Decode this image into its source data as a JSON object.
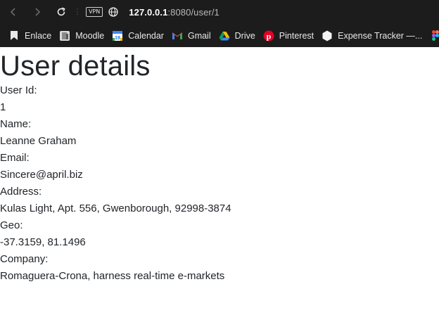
{
  "browser": {
    "vpn_label": "VPN",
    "url_host": "127.0.0.1",
    "url_path": ":8080/user/1"
  },
  "bookmarks": [
    {
      "label": "Enlace",
      "icon": "bookmark-folder-icon"
    },
    {
      "label": "Moodle",
      "icon": "moodle-icon"
    },
    {
      "label": "Calendar",
      "icon": "calendar-icon"
    },
    {
      "label": "Gmail",
      "icon": "gmail-icon"
    },
    {
      "label": "Drive",
      "icon": "drive-icon"
    },
    {
      "label": "Pinterest",
      "icon": "pinterest-icon"
    },
    {
      "label": "Expense Tracker —...",
      "icon": "hexagon-icon"
    }
  ],
  "page": {
    "title": "User details",
    "fields": [
      {
        "label": "User Id:",
        "value": "1"
      },
      {
        "label": "Name:",
        "value": "Leanne Graham"
      },
      {
        "label": "Email:",
        "value": "Sincere@april.biz"
      },
      {
        "label": "Address:",
        "value": "Kulas Light, Apt. 556, Gwenborough, 92998-3874"
      },
      {
        "label": "Geo:",
        "value": "-37.3159, 81.1496"
      },
      {
        "label": "Company:",
        "value": "Romaguera-Crona, harness real-time e-markets"
      }
    ]
  },
  "colors": {
    "chrome_bg": "#1c1c1c",
    "text": "#212529",
    "gmail_red": "#ea4335",
    "pinterest_red": "#e60023"
  }
}
